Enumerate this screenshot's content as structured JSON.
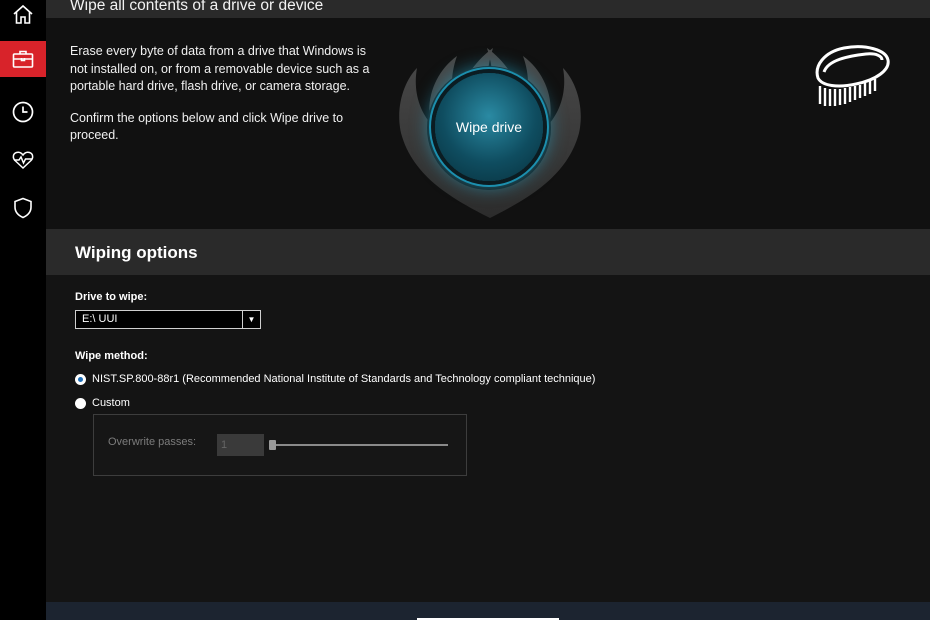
{
  "nav": {
    "items": [
      {
        "icon": "home-icon"
      },
      {
        "icon": "toolbox-icon",
        "active": true
      },
      {
        "icon": "clock-icon"
      },
      {
        "icon": "heartbeat-icon"
      },
      {
        "icon": "shield-icon"
      }
    ],
    "accent_color": "#d8232a"
  },
  "hero": {
    "title": "Wipe all contents of a drive or device",
    "description_1": "Erase every byte of data from a drive that Windows is not installed on, or  from a removable device such as a portable hard drive, flash drive, or camera storage.",
    "description_2": "Confirm the options below and click Wipe drive to proceed.",
    "wipe_button_label": "Wipe drive",
    "glow_color": "#28bee6"
  },
  "options": {
    "title": "Wiping options",
    "drive_label": "Drive to wipe:",
    "drive_selected": "E:\\ UUI",
    "method_label": "Wipe method:",
    "methods": [
      {
        "label": "NIST.SP.800-88r1 (Recommended National Institute of Standards and Technology compliant technique)",
        "checked": true
      },
      {
        "label": "Custom",
        "checked": false
      }
    ],
    "custom": {
      "overwrite_label": "Overwrite passes:",
      "passes_value": "1"
    }
  }
}
